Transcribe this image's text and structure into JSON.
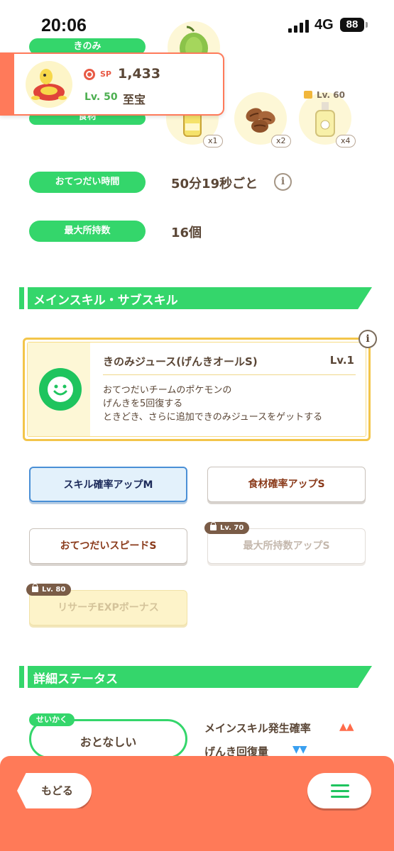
{
  "status_bar": {
    "time": "20:06",
    "network": "4G",
    "battery": "88"
  },
  "top_rows": {
    "berry_label": "きのみ",
    "ingredients_label": "食材",
    "ingredient_counts": [
      "x1",
      "x2",
      "x4"
    ],
    "locked_level": "Lv. 60"
  },
  "pokemon_card": {
    "sp_label": "SP",
    "sp_value": "1,433",
    "level": "Lv. 50",
    "subskill": "至宝"
  },
  "help_time": {
    "label": "おてつだい時間",
    "value": "50分19秒ごと",
    "info_icon": "i"
  },
  "max_carry": {
    "label": "最大所持数",
    "value": "16個"
  },
  "skills_section": {
    "title": "メインスキル・サブスキル"
  },
  "main_skill": {
    "name": "きのみジュース(げんきオールS)",
    "level": "Lv.1",
    "description": [
      "おてつだいチームのポケモンの",
      "げんきを5回復する",
      "ときどき、さらに追加できのみジュースをゲットする"
    ],
    "info_icon": "i"
  },
  "sub_skills": [
    {
      "label": "スキル確率アップM",
      "state": "active"
    },
    {
      "label": "食材確率アップS",
      "state": "normal"
    },
    {
      "label": "おてつだいスピードS",
      "state": "normal"
    },
    {
      "label": "最大所持数アップS",
      "state": "locked",
      "lock_level": "Lv. 70"
    },
    {
      "label": "リサーチEXPボーナス",
      "state": "locked-gold",
      "lock_level": "Lv. 80"
    }
  ],
  "detail_section": {
    "title": "詳細ステータス"
  },
  "nature": {
    "tag": "せいかく",
    "value": "おとなしい",
    "effects": [
      {
        "label": "メインスキル発生確率",
        "arrows": "▲▲",
        "color": "#ff6b4a"
      },
      {
        "label": "げんき回復量",
        "arrows": "▼▼",
        "color": "#3aa0f0"
      }
    ]
  },
  "bottom_bar": {
    "back_label": "もどる"
  },
  "colors": {
    "accent_green": "#34d66b",
    "accent_orange": "#ff7a58",
    "active_blue": "#4a8fd6",
    "skill_gold": "#f3c54a"
  }
}
